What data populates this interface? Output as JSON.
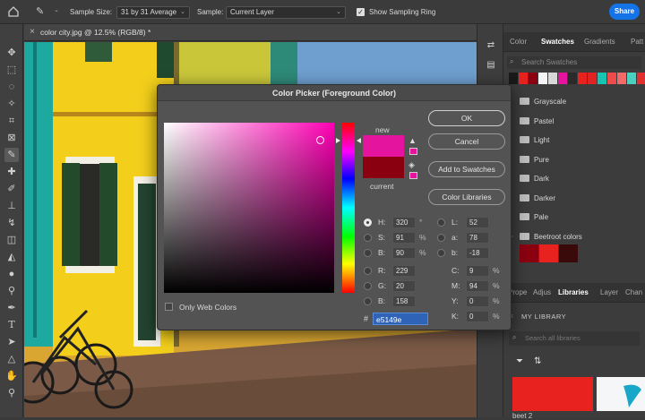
{
  "options_bar": {
    "sample_size_label": "Sample Size:",
    "sample_size_value": "31 by 31 Average",
    "sample_label": "Sample:",
    "sample_value": "Current Layer",
    "show_sampling_ring_label": "Show Sampling Ring",
    "share_label": "Share"
  },
  "document": {
    "tab_title": "color city.jpg @ 12.5% (RGB/8) *",
    "close_glyph": "×"
  },
  "dialog": {
    "title": "Color Picker (Foreground Color)",
    "new_label": "new",
    "current_label": "current",
    "new_color": "#e5149e",
    "current_color": "#8b0010",
    "buttons": {
      "ok": "OK",
      "cancel": "Cancel",
      "add_to_swatches": "Add to Swatches",
      "color_libraries": "Color Libraries"
    },
    "only_web_colors_label": "Only Web Colors",
    "hsb": [
      {
        "label": "H:",
        "value": "320",
        "unit": "°",
        "selected": true
      },
      {
        "label": "S:",
        "value": "91",
        "unit": "%"
      },
      {
        "label": "B:",
        "value": "90",
        "unit": "%"
      }
    ],
    "rgb": [
      {
        "label": "R:",
        "value": "229"
      },
      {
        "label": "G:",
        "value": "20"
      },
      {
        "label": "B:",
        "value": "158"
      }
    ],
    "lab": [
      {
        "label": "L:",
        "value": "52"
      },
      {
        "label": "a:",
        "value": "78"
      },
      {
        "label": "b:",
        "value": "-18"
      }
    ],
    "cmyk": [
      {
        "label": "C:",
        "value": "9",
        "unit": "%"
      },
      {
        "label": "M:",
        "value": "94",
        "unit": "%"
      },
      {
        "label": "Y:",
        "value": "0",
        "unit": "%"
      },
      {
        "label": "K:",
        "value": "0",
        "unit": "%"
      }
    ],
    "hex_label": "#",
    "hex_value": "e5149e"
  },
  "swatches_panel": {
    "tabs": [
      "Color",
      "Swatches",
      "Gradients",
      "Patt"
    ],
    "active_tab": "Swatches",
    "search_placeholder": "Search Swatches",
    "recent_colors": [
      "#1a1a1a",
      "#e8231f",
      "#8b0010",
      "#f5f5f5",
      "#d8d8d8",
      "#e5149e",
      "#2a2a2a",
      "#e8231f",
      "#e02424",
      "#17c3b2",
      "#f04a4a",
      "#f26a6a",
      "#4ad0c0",
      "#e03030"
    ],
    "folders": [
      "Grayscale",
      "Pastel",
      "Light",
      "Pure",
      "Dark",
      "Darker",
      "Pale",
      "Beetroot colors"
    ],
    "beetroot_swatches": [
      "#8b0010",
      "#e8231f",
      "#3a0a0a"
    ]
  },
  "libraries_panel": {
    "tabs": [
      "Prope",
      "Adjus",
      "Libraries",
      "Layer",
      "Chan"
    ],
    "active_tab": "Libraries",
    "library_name": "MY LIBRARY",
    "search_placeholder": "Search all libraries",
    "item_label": "beet 2"
  }
}
